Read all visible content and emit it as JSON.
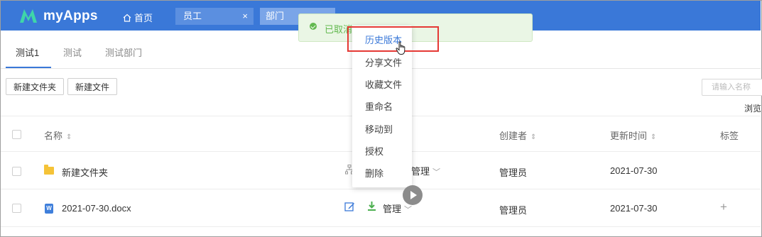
{
  "header": {
    "brand": "myApps",
    "home_label": "首页",
    "tabs": [
      {
        "label": "员工",
        "close": "×"
      },
      {
        "label": "部门"
      }
    ]
  },
  "toast": {
    "message": "已取消"
  },
  "subtabs": [
    "测试1",
    "测试",
    "测试部门"
  ],
  "toolbar": {
    "new_folder": "新建文件夹",
    "new_file": "新建文件",
    "search_placeholder": "请输入名称",
    "browse_label": "浏览"
  },
  "table": {
    "headers": {
      "name": "名称",
      "creator": "创建者",
      "updated": "更新时间",
      "tags": "标签"
    },
    "sort_glyph": "⇕",
    "rows": [
      {
        "name": "新建文件夹",
        "type": "folder",
        "perm": "管理",
        "creator": "管理员",
        "updated": "2021-07-30",
        "tag": ""
      },
      {
        "name": "2021-07-30.docx",
        "type": "docx",
        "perm": "管理",
        "creator": "管理员",
        "updated": "2021-07-30",
        "tag": "+"
      }
    ]
  },
  "context_menu": {
    "items": [
      "历史版本",
      "分享文件",
      "收藏文件",
      "重命名",
      "移动到",
      "授权",
      "删除"
    ]
  },
  "colors": {
    "accent": "#3a78d8",
    "success": "#63b950",
    "highlight": "#e53935",
    "folder": "#f5c338"
  }
}
